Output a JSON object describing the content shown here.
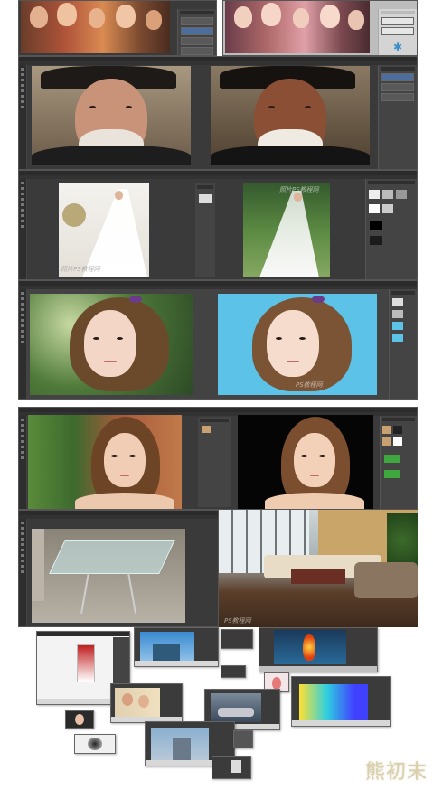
{
  "watermark": {
    "row3_left": "照片PS教程网",
    "row3_right": "照片PS教程网",
    "row4_right": "PS教程网",
    "row6": "PS教程网"
  },
  "logo": {
    "text": "熊初末"
  },
  "colors": {
    "ps_bg": "#3a3a3a",
    "panel": "#444444",
    "sky_blue": "#5cc2e8",
    "layer_select": "#4d6e9c"
  },
  "icons": [
    "layer-thumbnail-icon",
    "tool-icon",
    "mask-icon"
  ]
}
